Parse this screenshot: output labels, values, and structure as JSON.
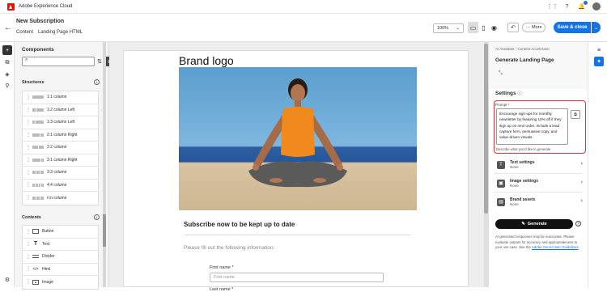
{
  "app": {
    "title": "Adobe Experience Cloud"
  },
  "header": {
    "title": "New Subscription",
    "breadcrumbs": [
      "Content",
      "Landing Page HTML"
    ],
    "zoom": "100%",
    "more_label": "More",
    "save_label": "Save & close"
  },
  "components": {
    "title": "Components",
    "search_placeholder": "",
    "structures_title": "Structures",
    "structures": [
      "1:1 column",
      "1:2 column Left",
      "1:3 column Left",
      "2:1 column Right",
      "2:2 column",
      "3:1 column Right",
      "3:3 column",
      "4:4 column",
      "n:n column"
    ],
    "contents_title": "Contents",
    "contents": [
      {
        "label": "Button",
        "icon": "button-icon"
      },
      {
        "label": "Text",
        "icon": "text-icon"
      },
      {
        "label": "Divider",
        "icon": "divider-icon"
      },
      {
        "label": "Html",
        "icon": "code-icon"
      },
      {
        "label": "Image",
        "icon": "image-icon"
      }
    ]
  },
  "canvas": {
    "brand_logo": "Brand logo",
    "heading": "Subscribe now to be kept up to date",
    "subtext": "Please fill out the following information:",
    "first_name_label": "First name *",
    "first_name_placeholder": "First name",
    "last_name_label": "Last name *"
  },
  "ai_panel": {
    "caption": "AI Assistant - Content Accelerator",
    "title": "Generate Landing Page",
    "settings_title": "Settings",
    "prompt_label": "Prompt *",
    "prompt_text": "Encourage sign-ups for monthly newsletter by featuring 10% off if they sign up on next order. Include a lead capture form, persuasive copy, and value-driven visuals.",
    "prompt_hint": "Describe what you'd like to generate.",
    "settings_rows": [
      {
        "title": "Text settings",
        "value": "None",
        "icon": "text-settings-icon"
      },
      {
        "title": "Image settings",
        "value": "None",
        "icon": "image-settings-icon"
      },
      {
        "title": "Brand assets",
        "value": "None",
        "icon": "brand-assets-icon"
      }
    ],
    "generate_label": "Generate",
    "disclaimer": "AI generated responses may be inaccurate. Please evaluate outputs for accuracy and appropriateness to your use case. See the",
    "disclaimer_link": "Adobe GenAI User Guidelines",
    "disclaimer_end": "."
  },
  "colors": {
    "accent": "#1473e6",
    "highlight": "#d7373f",
    "brand": "#eb1000"
  }
}
